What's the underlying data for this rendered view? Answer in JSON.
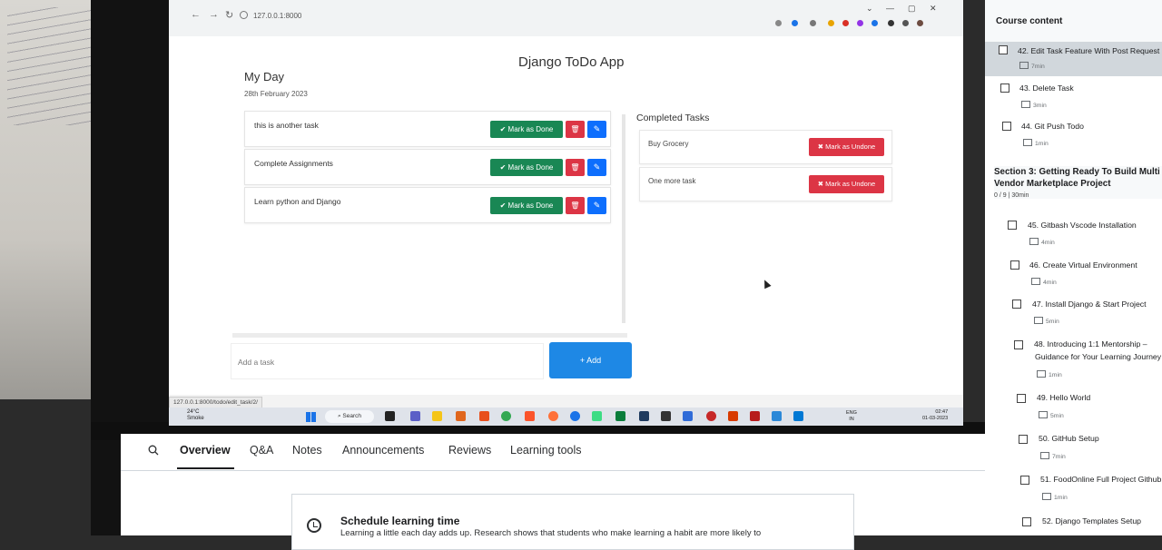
{
  "browser": {
    "url": "127.0.0.1:8000",
    "status_url": "127.0.0.1:8000/todo/edit_task/2/"
  },
  "app": {
    "title": "Django ToDo App",
    "heading": "My Day",
    "date": "28th February 2023",
    "tasks": [
      {
        "text": "this is another task",
        "done_label": "✔ Mark as Done"
      },
      {
        "text": "Complete Assignments",
        "done_label": "✔ Mark as Done"
      },
      {
        "text": "Learn python and Django",
        "done_label": "✔ Mark as Done"
      }
    ],
    "completed_title": "Completed Tasks",
    "completed": [
      {
        "text": "Buy Grocery",
        "undo_label": "✖ Mark as Undone"
      },
      {
        "text": "One more task",
        "undo_label": "✖ Mark as Undone"
      }
    ],
    "add_placeholder": "Add a task",
    "add_label": "+ Add"
  },
  "taskbar": {
    "weather_temp": "24°C",
    "weather_desc": "Smoke",
    "search": "Search",
    "lang": "ENG",
    "region": "IN",
    "time": "02:47",
    "date": "01-03-2023"
  },
  "course_page": {
    "tabs": [
      "Overview",
      "Q&A",
      "Notes",
      "Announcements",
      "Reviews",
      "Learning tools"
    ],
    "card_title": "Schedule learning time",
    "card_text": "Learning a little each day adds up. Research shows that students who make learning a habit are more likely to"
  },
  "sidebar": {
    "title": "Course content",
    "items_top": [
      {
        "label": "42. Edit Task Feature With Post Request",
        "meta": "7min"
      },
      {
        "label": "43. Delete Task",
        "meta": "3min"
      },
      {
        "label": "44. Git Push Todo",
        "meta": "1min"
      }
    ],
    "section_title": "Section 3: Getting Ready To Build Multi Vendor Marketplace Project",
    "section_meta": "0 / 9 | 30min",
    "items": [
      {
        "label": "45. Gitbash Vscode Installation",
        "meta": "4min"
      },
      {
        "label": "46. Create Virtual Environment",
        "meta": "4min"
      },
      {
        "label": "47. Install Django & Start Project",
        "meta": "5min"
      },
      {
        "label": "48. Introducing 1:1 Mentorship –",
        "label2": "Guidance for Your Learning Journey",
        "meta": "1min"
      },
      {
        "label": "49. Hello World",
        "meta": "5min"
      },
      {
        "label": "50. GitHub Setup",
        "meta": "7min"
      },
      {
        "label": "51. FoodOnline Full Project Github",
        "meta": "1min"
      },
      {
        "label": "52. Django Templates Setup",
        "meta": ""
      }
    ]
  }
}
